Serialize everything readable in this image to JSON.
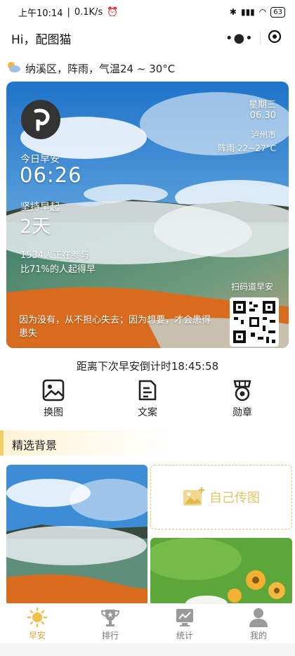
{
  "status": {
    "time": "上午10:14",
    "speed": "0.1K/s",
    "battery": "63"
  },
  "navbar": {
    "title": "Hi，配图猫"
  },
  "weather": {
    "text": "纳溪区，阵雨，气温24 ~ 30°C",
    "icon": "partly-cloudy-icon"
  },
  "card": {
    "greeting": "今日早安",
    "time": "06:26",
    "streak_label": "坚持早起",
    "streak_value": "2天",
    "participants": "1534人正在参与",
    "percent": "比71%的人起得早",
    "weekday": "星期三",
    "date": "06.30",
    "city": "泸州市",
    "weather": "阵雨 22~27°C",
    "qr_caption": "扫码道早安",
    "quote": "因为没有，从不担心失去；因为想要，才会患得患失"
  },
  "countdown": "距离下次早安倒计时18:45:58",
  "actions": [
    {
      "label": "换图",
      "icon": "image-icon"
    },
    {
      "label": "文案",
      "icon": "document-icon"
    },
    {
      "label": "勋章",
      "icon": "medal-icon"
    }
  ],
  "section_title": "精选背景",
  "upload_label": "自己传图",
  "tabs": [
    {
      "label": "早安",
      "icon": "sun-icon",
      "active": true
    },
    {
      "label": "排行",
      "icon": "trophy-icon",
      "active": false
    },
    {
      "label": "统计",
      "icon": "chart-icon",
      "active": false
    },
    {
      "label": "我的",
      "icon": "user-icon",
      "active": false
    }
  ],
  "colors": {
    "accent": "#d9a534",
    "section_bar": "#f1cf6b",
    "dashed": "#e3c76e"
  }
}
